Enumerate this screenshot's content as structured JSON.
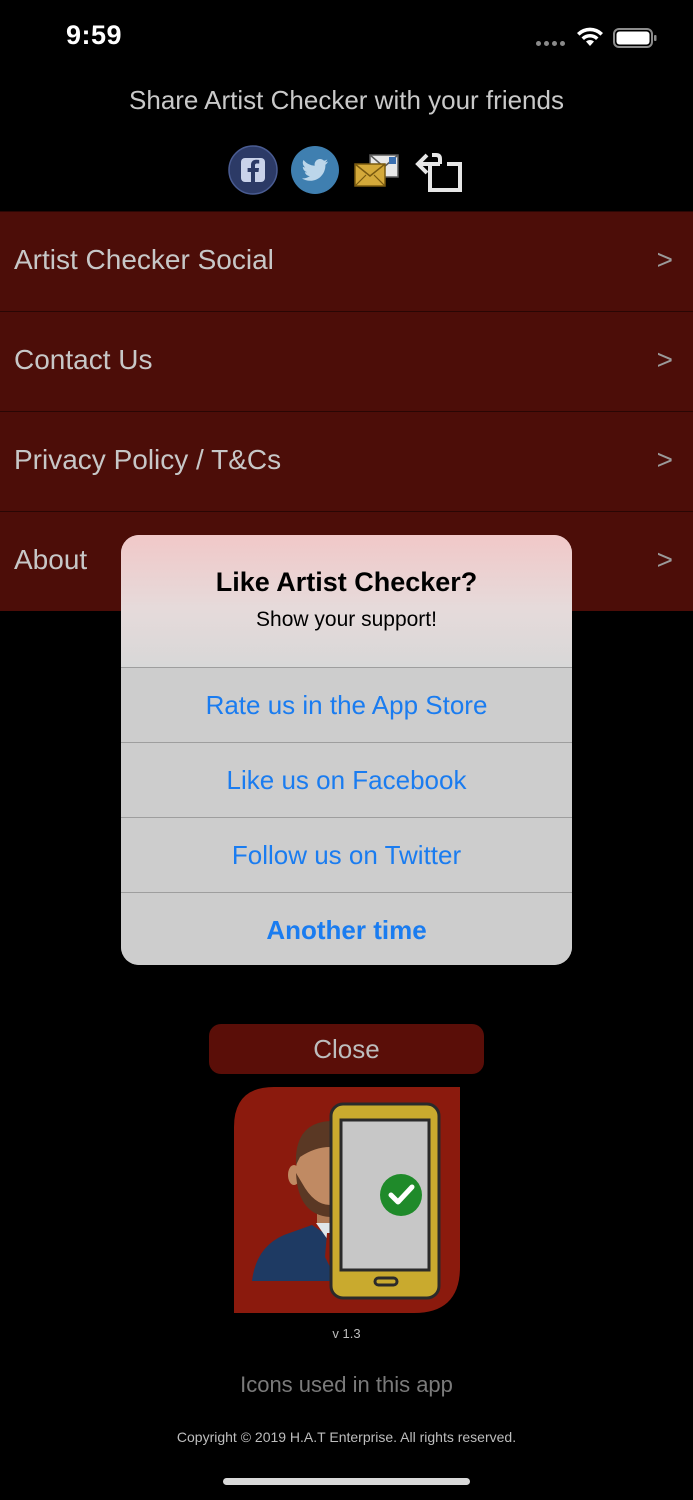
{
  "status_bar": {
    "time": "9:59"
  },
  "share": {
    "title": "Share Artist Checker with your friends",
    "icons": [
      "facebook-icon",
      "twitter-icon",
      "email-icon",
      "share-icon"
    ]
  },
  "menu": {
    "items": [
      {
        "label": "Artist Checker Social",
        "chevron": ">"
      },
      {
        "label": "Contact Us",
        "chevron": ">"
      },
      {
        "label": "Privacy Policy / T&Cs",
        "chevron": ">"
      },
      {
        "label": "About",
        "chevron": ">"
      }
    ]
  },
  "alert": {
    "title": "Like Artist Checker?",
    "message": "Show your support!",
    "buttons": [
      {
        "label": "Rate us in the App Store"
      },
      {
        "label": "Like us on Facebook"
      },
      {
        "label": "Follow us on Twitter"
      },
      {
        "label": "Another time"
      }
    ]
  },
  "close_label": "Close",
  "version": "v 1.3",
  "icons_used": "Icons used in this app",
  "copyright": "Copyright © 2019 H.A.T Enterprise. All rights reserved.",
  "colors": {
    "menu_bg": "#4c0d08",
    "alert_button_text": "#1a7cf0",
    "logo_red": "#8b1a0d"
  }
}
